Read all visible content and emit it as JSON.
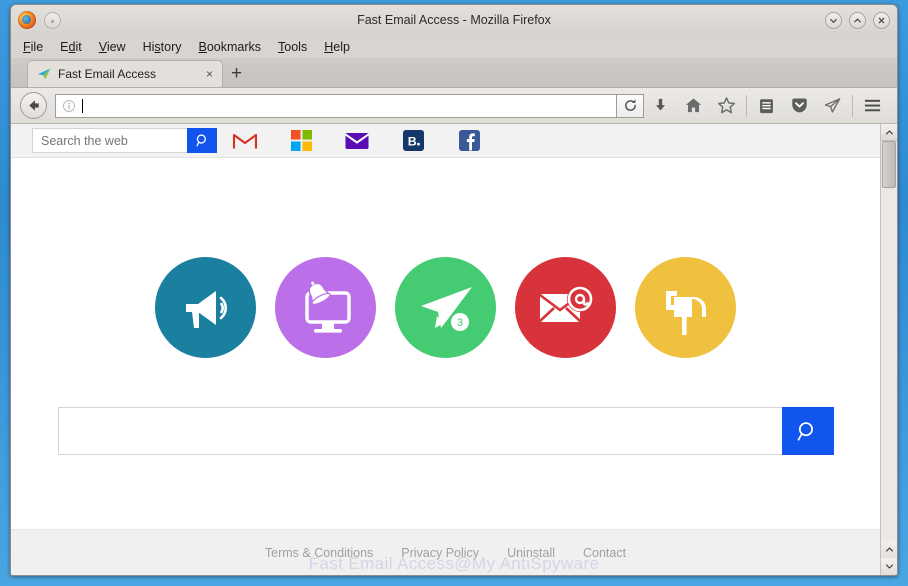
{
  "window": {
    "title": "Fast Email Access - Mozilla Firefox",
    "controls": [
      {
        "name": "minimize",
        "glyph": "chevron-down"
      },
      {
        "name": "maximize",
        "glyph": "chevron-up"
      },
      {
        "name": "close",
        "glyph": "close"
      }
    ]
  },
  "menubar": {
    "items": [
      {
        "label": "File",
        "accel": "F"
      },
      {
        "label": "Edit",
        "accel": "E"
      },
      {
        "label": "View",
        "accel": "V"
      },
      {
        "label": "History",
        "accel": "s"
      },
      {
        "label": "Bookmarks",
        "accel": "B"
      },
      {
        "label": "Tools",
        "accel": "T"
      },
      {
        "label": "Help",
        "accel": "H"
      }
    ]
  },
  "tabs": {
    "active": {
      "label": "Fast Email Access",
      "favicon": "paper-plane-icon",
      "close_glyph": "×"
    },
    "new_tab_glyph": "+"
  },
  "toolbar": {
    "back_icon": "back-arrow-icon",
    "url_value": "",
    "url_placeholder": "",
    "identity_icon": "info-icon",
    "reload_icon": "reload-icon",
    "buttons": [
      {
        "name": "downloads-button",
        "icon": "download-arrow-icon"
      },
      {
        "name": "home-button",
        "icon": "home-icon"
      },
      {
        "name": "bookmark-button",
        "icon": "star-icon"
      },
      {
        "name": "reading-list-button",
        "icon": "clipboard-icon"
      },
      {
        "name": "pocket-button",
        "icon": "pocket-shield-icon"
      },
      {
        "name": "sync-send-button",
        "icon": "send-plane-icon"
      },
      {
        "name": "menu-button",
        "icon": "hamburger-menu-icon"
      }
    ]
  },
  "page": {
    "quickbar": {
      "search_placeholder": "Search the web",
      "search_value": "",
      "search_button_icon": "search-icon",
      "links": [
        {
          "name": "gmail",
          "label": "M",
          "icon": "gmail-icon"
        },
        {
          "name": "outlook",
          "label": "",
          "icon": "microsoft-squares-icon"
        },
        {
          "name": "yahoo-mail",
          "label": "",
          "icon": "purple-envelope-icon"
        },
        {
          "name": "b-mail",
          "label": "B.",
          "icon": "b-dot-icon"
        },
        {
          "name": "facebook",
          "label": "f",
          "icon": "facebook-icon"
        }
      ]
    },
    "circles": [
      {
        "name": "announcements",
        "icon": "megaphone-icon",
        "color": "#1b7fa0",
        "badge": ""
      },
      {
        "name": "notifications",
        "icon": "monitor-bell-icon",
        "color": "#bb6fe8",
        "badge": ""
      },
      {
        "name": "send-mail",
        "icon": "paper-plane-icon",
        "color": "#45cb72",
        "badge": "3"
      },
      {
        "name": "inbox",
        "icon": "envelope-at-icon",
        "color": "#d8333b",
        "badge": ""
      },
      {
        "name": "mailbox",
        "icon": "mailbox-icon",
        "color": "#f0c03f",
        "badge": ""
      }
    ],
    "search": {
      "value": "",
      "placeholder": "",
      "button_icon": "search-icon"
    },
    "footer_links": [
      {
        "label": "Terms & Conditions"
      },
      {
        "label": "Privacy Policy"
      },
      {
        "label": "Uninstall"
      },
      {
        "label": "Contact"
      }
    ],
    "watermark": "Fast Email Access@My AntiSpyware"
  },
  "scrollbar": {
    "up_glyph": "∧",
    "down_glyph": "∨"
  },
  "colors": {
    "accent_blue": "#1155ee",
    "teal": "#1b7fa0",
    "purple": "#bb6fe8",
    "green": "#45cb72",
    "red": "#d8333b",
    "yellow": "#f0c03f"
  }
}
